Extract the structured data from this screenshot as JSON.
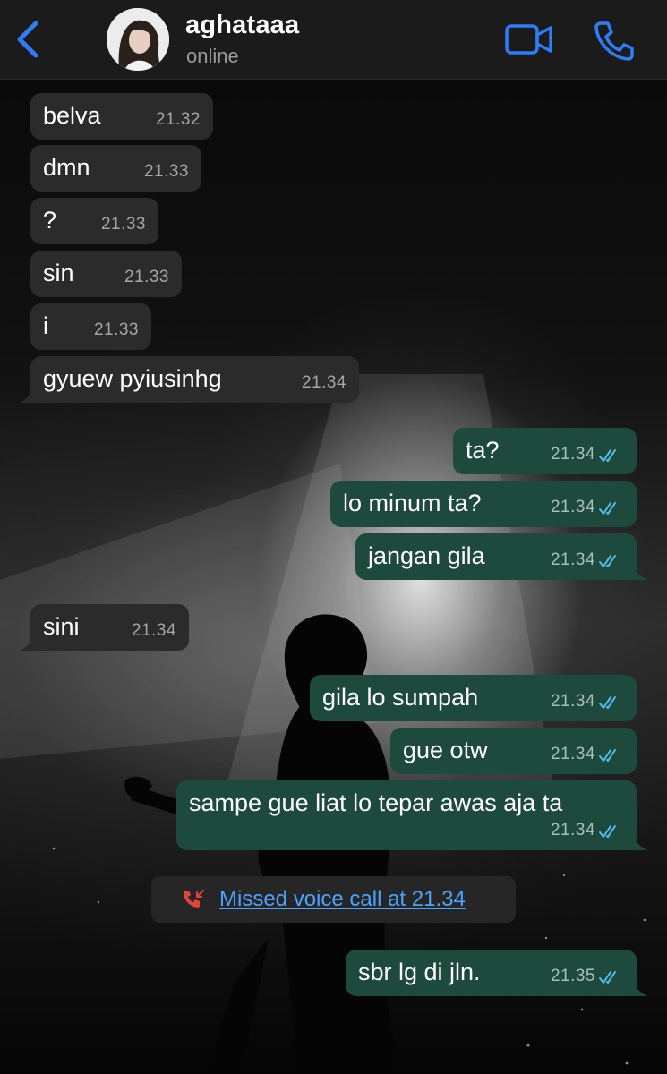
{
  "header": {
    "contact_name": "aghataaa",
    "status": "online"
  },
  "colors": {
    "accent": "#2f7df6",
    "incoming_bubble": "#2b2b2b",
    "outgoing_bubble": "#1d4a3d",
    "read_ticks": "#53bdeb",
    "missed_call_red": "#e0443a",
    "link_blue": "#4aa3ff"
  },
  "icons": {
    "back": "chevron-left-icon",
    "video": "video-camera-icon",
    "call": "phone-icon",
    "ticks": "double-check-icon",
    "missed": "missed-call-icon"
  },
  "messages": [
    {
      "dir": "in",
      "text": "belva",
      "time": "21.32"
    },
    {
      "dir": "in",
      "text": "dmn",
      "time": "21.33"
    },
    {
      "dir": "in",
      "text": "?",
      "time": "21.33"
    },
    {
      "dir": "in",
      "text": "sin",
      "time": "21.33"
    },
    {
      "dir": "in",
      "text": "i",
      "time": "21.33"
    },
    {
      "dir": "in",
      "text": "gyuew pyiusinhg",
      "time": "21.34"
    },
    {
      "dir": "out",
      "text": "ta?",
      "time": "21.34",
      "read": true
    },
    {
      "dir": "out",
      "text": "lo minum ta?",
      "time": "21.34",
      "read": true
    },
    {
      "dir": "out",
      "text": "jangan gila",
      "time": "21.34",
      "read": true
    },
    {
      "dir": "in",
      "text": "sini",
      "time": "21.34"
    },
    {
      "dir": "out",
      "text": "gila lo sumpah",
      "time": "21.34",
      "read": true
    },
    {
      "dir": "out",
      "text": "gue otw",
      "time": "21.34",
      "read": true
    },
    {
      "dir": "out",
      "text": "sampe gue liat lo tepar awas aja ta",
      "time": "21.34",
      "read": true
    },
    {
      "dir": "out",
      "text": "sbr lg di jln.",
      "time": "21.35",
      "read": true
    }
  ],
  "missed_call": {
    "label": "Missed voice call at 21.34"
  }
}
